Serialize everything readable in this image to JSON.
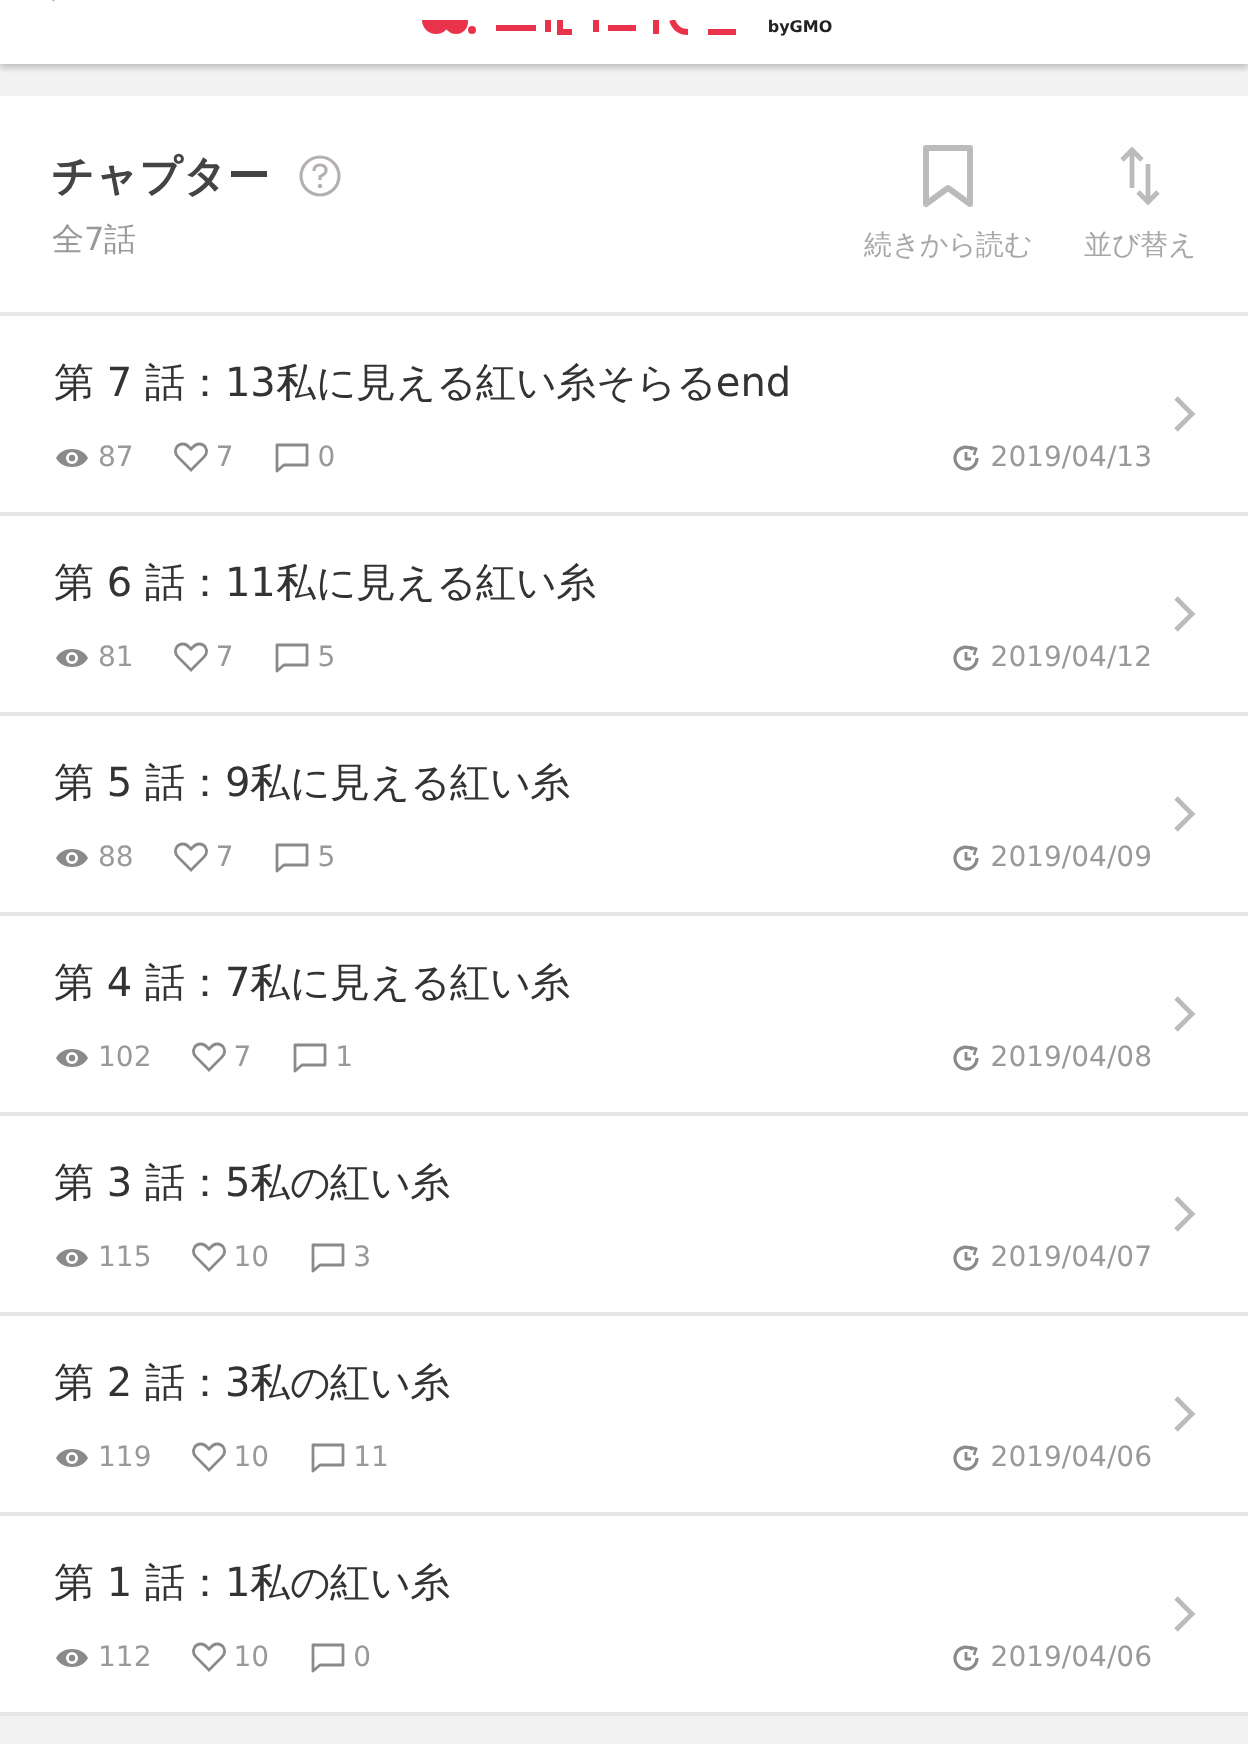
{
  "header": {
    "logo_suffix": "byGMO"
  },
  "chapters": {
    "title": "チャプター",
    "count": "全7話",
    "actions": [
      {
        "kind": "bookmark",
        "label": "続きから読む"
      },
      {
        "kind": "sort",
        "label": "並び替え"
      }
    ]
  },
  "episodes": [
    {
      "title": "第 7 話：13私に見える紅い糸そらるend",
      "views": "87",
      "likes": "7",
      "comments": "0",
      "date": "2019/04/13"
    },
    {
      "title": "第 6 話：11私に見える紅い糸",
      "views": "81",
      "likes": "7",
      "comments": "5",
      "date": "2019/04/12"
    },
    {
      "title": "第 5 話：9私に見える紅い糸",
      "views": "88",
      "likes": "7",
      "comments": "5",
      "date": "2019/04/09"
    },
    {
      "title": "第 4 話：7私に見える紅い糸",
      "views": "102",
      "likes": "7",
      "comments": "1",
      "date": "2019/04/08"
    },
    {
      "title": "第 3 話：5私の紅い糸",
      "views": "115",
      "likes": "10",
      "comments": "3",
      "date": "2019/04/07"
    },
    {
      "title": "第 2 話：3私の紅い糸",
      "views": "119",
      "likes": "10",
      "comments": "11",
      "date": "2019/04/06"
    },
    {
      "title": "第 1 話：1私の紅い糸",
      "views": "112",
      "likes": "10",
      "comments": "0",
      "date": "2019/04/06"
    }
  ]
}
